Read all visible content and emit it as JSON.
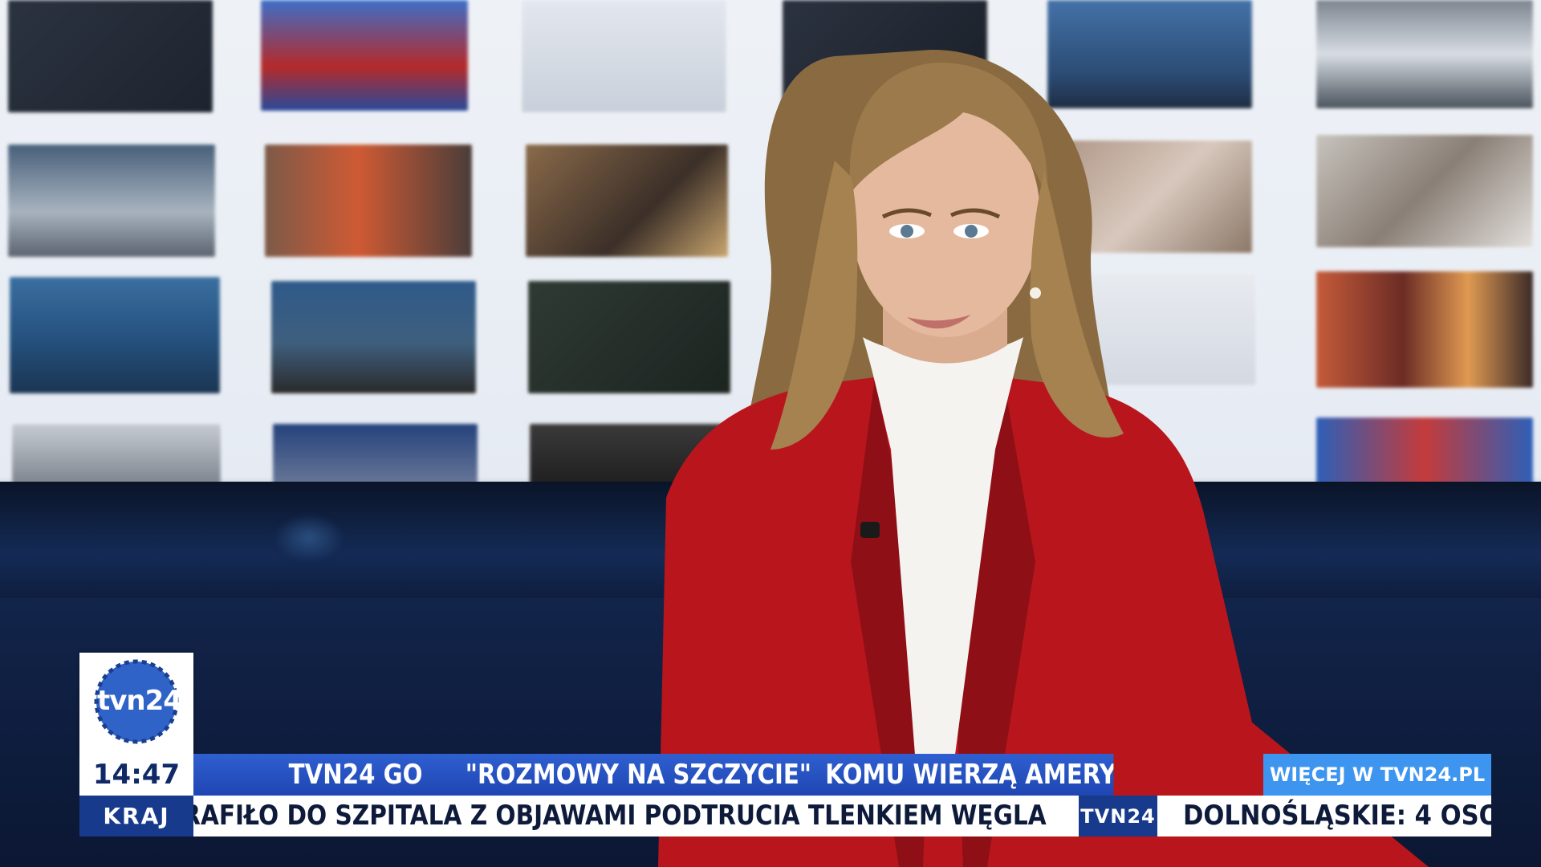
{
  "clock": "14:47",
  "category": "KRAJ",
  "headline": {
    "part1": "TVN24 GO",
    "part2": "\"ROZMOWY NA SZCZYCIE\"",
    "part3": "KOMU WIERZĄ AMERYKANIE?"
  },
  "more_link": "WIĘCEJ W TVN24.PL",
  "ticker": {
    "left": "TRAFIŁO DO SZPITALA Z OBJAWAMI PODTRUCIA TLENKIEM WĘGLA",
    "separator": "TVN24",
    "right": "DOLNOŚLĄSKIE: 4 OSO"
  },
  "logo": "tvn24",
  "colors": {
    "brand_blue": "#183a8c",
    "headline_blue": "#2f5fd0",
    "link_blue": "#3d95f0",
    "jacket_red": "#b8161c"
  }
}
